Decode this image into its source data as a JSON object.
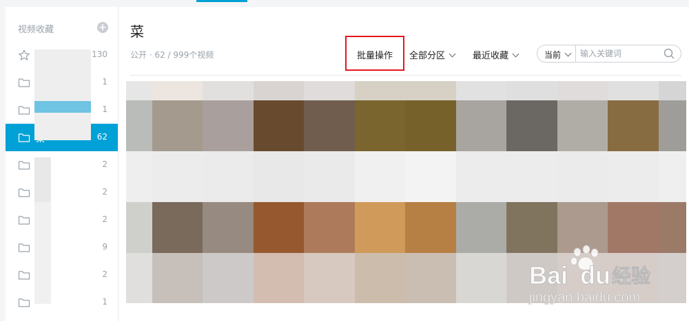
{
  "sidebar": {
    "title": "视频收藏",
    "add_symbol": "+",
    "items": [
      {
        "icon": "star-icon",
        "name": "",
        "count": "130",
        "active": false
      },
      {
        "icon": "folder-icon",
        "name": "",
        "count": "1",
        "active": false
      },
      {
        "icon": "folder-icon",
        "name": "",
        "count": "1",
        "active": false
      },
      {
        "icon": "folder-icon",
        "name": "菜",
        "count": "62",
        "active": true
      },
      {
        "icon": "folder-icon",
        "name": "",
        "count": "2",
        "active": false
      },
      {
        "icon": "folder-icon",
        "name": "",
        "count": "2",
        "active": false
      },
      {
        "icon": "folder-icon",
        "name": "",
        "count": "2",
        "active": false
      },
      {
        "icon": "folder-icon",
        "name": "",
        "count": "9",
        "active": false
      },
      {
        "icon": "folder-icon",
        "name": "",
        "count": "2",
        "active": false
      },
      {
        "icon": "folder-icon",
        "name": "",
        "count": "1",
        "active": false
      }
    ]
  },
  "main": {
    "title": "菜",
    "meta": "公开 · 62 / 999个视频",
    "batch_label": "批量操作",
    "partition_label": "全部分区",
    "sort_label": "最近收藏",
    "search": {
      "scope": "当前",
      "placeholder": "输入关键词",
      "value": ""
    }
  },
  "accent_color": "#00a1d6",
  "highlight_color": "#e3161c",
  "mosaic_colors": [
    [
      "#e6e6e6",
      "#ede6e0",
      "#e2e0df",
      "#d9d4d1",
      "#e0dcdb",
      "#d6d1c4",
      "#d6d1c4",
      "#e1e1e1",
      "#dfdfdf",
      "#dfdcdb",
      "#e0e0e0",
      "#d5d5d5"
    ],
    [
      "#b9bcb8",
      "#a49a8e",
      "#a9a09d",
      "#684a2f",
      "#705d4e",
      "#7a652e",
      "#756129",
      "#a8a49f",
      "#6b6762",
      "#b0ada6",
      "#886c41",
      "#9e9d99"
    ],
    [
      "#eeeeee",
      "#ececec",
      "#ebebeb",
      "#e8e8e8",
      "#eaeaea",
      "#f0f0f0",
      "#f3f3f3",
      "#ececec",
      "#ececec",
      "#ebebeb",
      "#ececec",
      "#efefef"
    ],
    [
      "#cfd0cc",
      "#7a6a5c",
      "#978a80",
      "#95582f",
      "#ad7b5b",
      "#d09a5a",
      "#b67f44",
      "#abaca7",
      "#81745f",
      "#ad9a8f",
      "#a17866",
      "#9b7a68"
    ],
    [
      "#e0dfde",
      "#c6bfba",
      "#cdc9c9",
      "#d2bdb0",
      "#d8c9c0",
      "#ccbcab",
      "#cabdb1",
      "#d9d7d4",
      "#cfc9c5",
      "#d6ccc8",
      "#d6ccc8",
      "#d4cfcd"
    ]
  ],
  "watermark": {
    "brand_left": "Bai",
    "brand_right": "du",
    "product": "经验",
    "url": "jingyan.baidu.com"
  }
}
